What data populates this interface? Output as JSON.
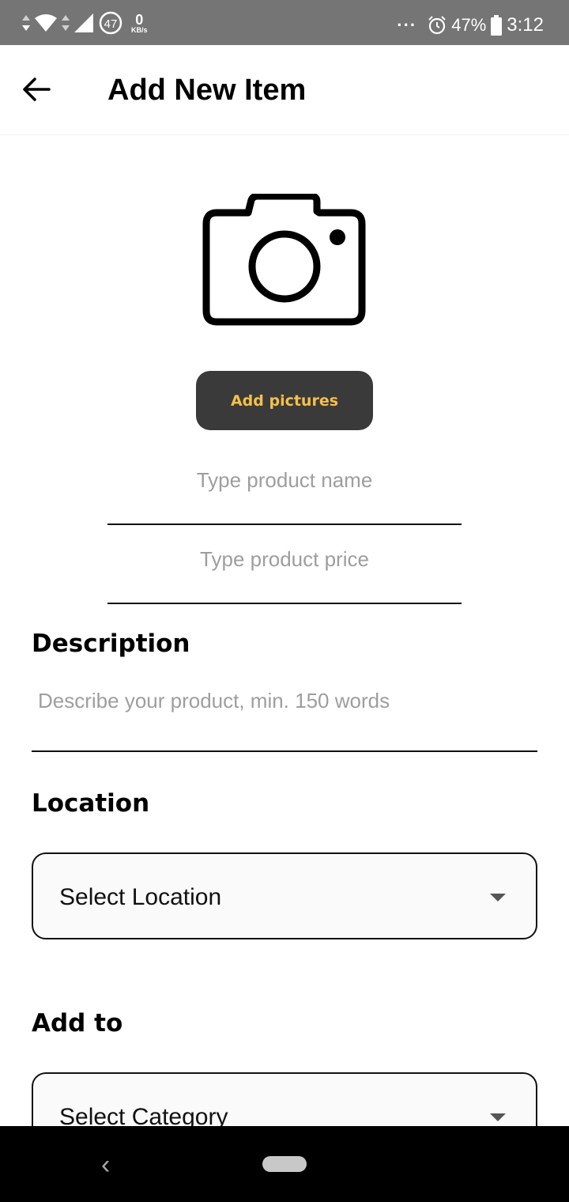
{
  "status_bar": {
    "signal_badge": "47",
    "net_speed_value": "0",
    "net_speed_unit": "KB/s",
    "dots": "···",
    "battery_percent": "47%",
    "time": "3:12"
  },
  "header": {
    "title": "Add New Item"
  },
  "media": {
    "add_pictures_label": "Add pictures"
  },
  "form": {
    "name_placeholder": "Type product name",
    "price_placeholder": "Type product price",
    "description_label": "Description",
    "description_placeholder": "Describe your product, min. 150 words",
    "location_label": "Location",
    "location_select": "Select Location",
    "add_to_label": "Add to",
    "category_select": "Select Category"
  },
  "nav": {
    "back_glyph": "‹"
  },
  "colors": {
    "status_bar_bg": "#757575",
    "button_bg": "#3a3a3a",
    "button_text": "#f5c04a"
  },
  "icons": [
    "back-arrow-icon",
    "camera-icon",
    "dropdown-caret-icon",
    "wifi-icon",
    "signal-icon",
    "alarm-icon",
    "battery-icon"
  ]
}
